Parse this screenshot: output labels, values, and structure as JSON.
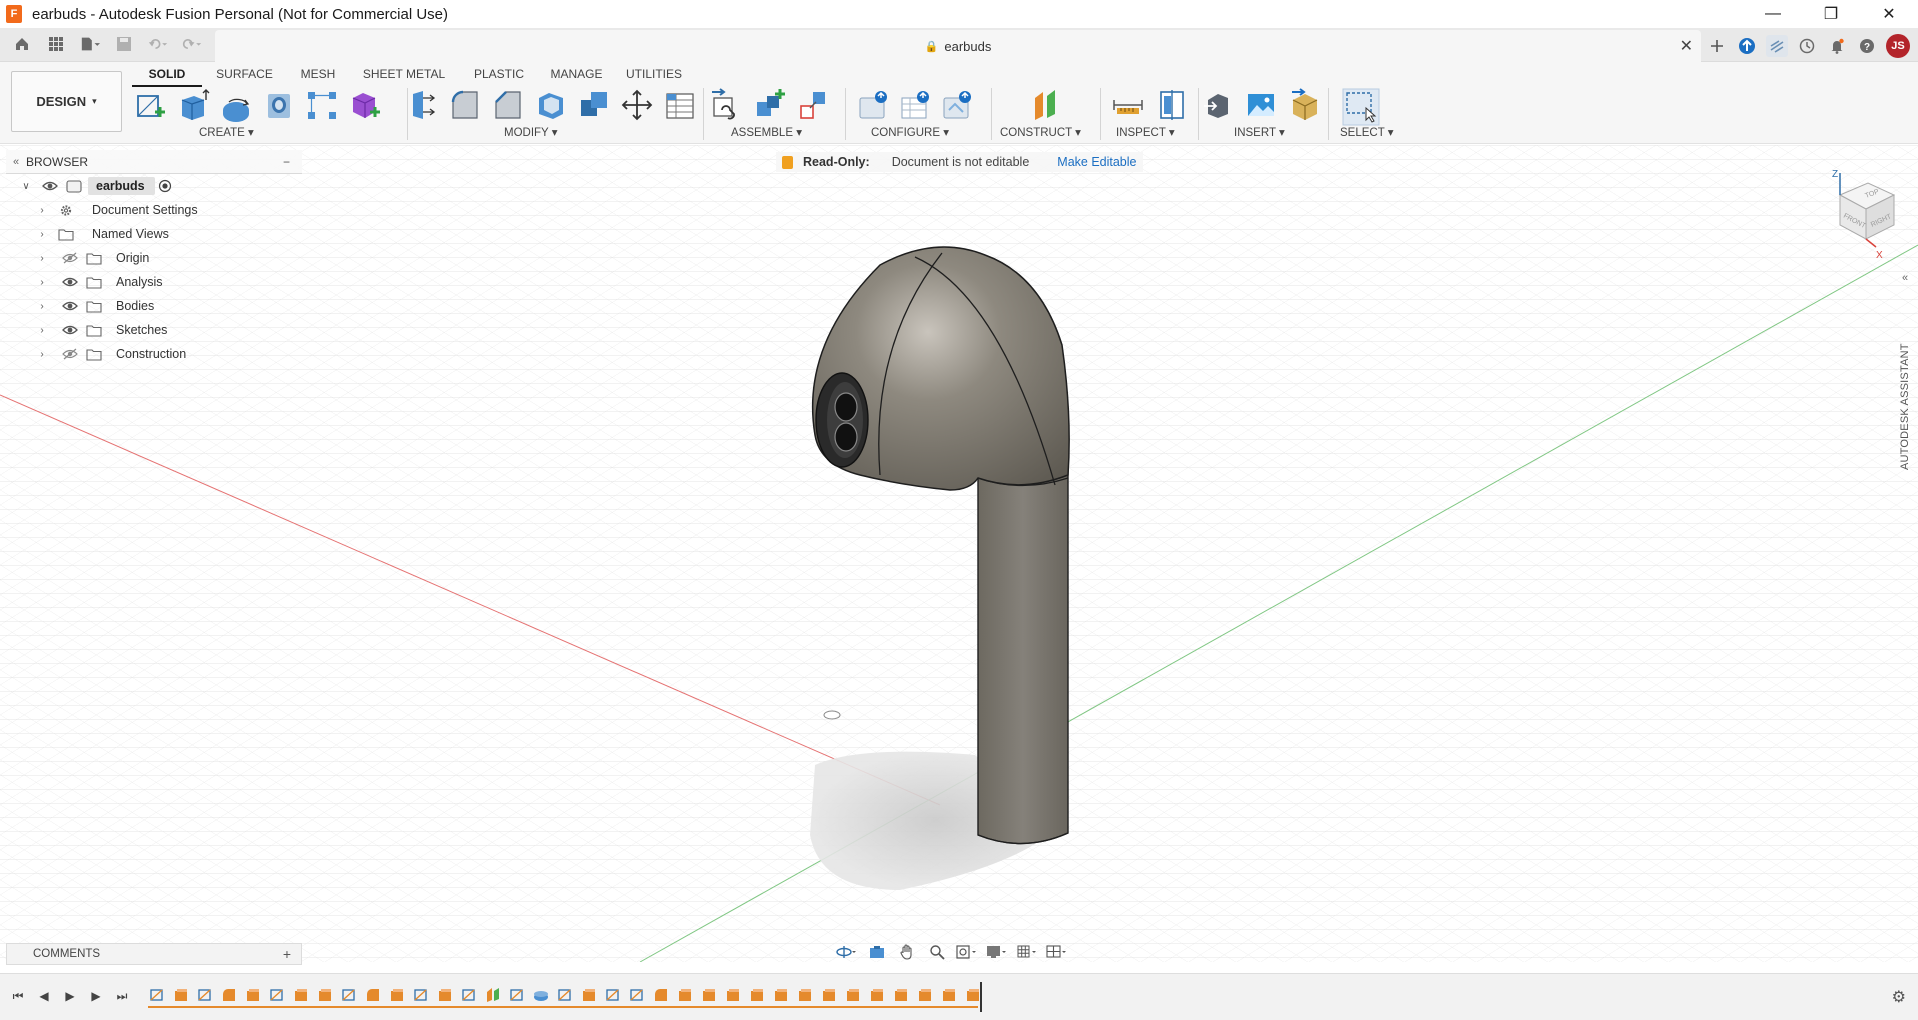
{
  "window": {
    "title": "earbuds - Autodesk Fusion Personal (Not for Commercial Use)",
    "app_logo": "F",
    "controls": [
      "minimize-icon",
      "restore-icon",
      "close-icon"
    ]
  },
  "doc_tab": {
    "title": "earbuds"
  },
  "user": {
    "initials": "JS"
  },
  "ribbon": {
    "workspace": "DESIGN",
    "tabs": [
      "SOLID",
      "SURFACE",
      "MESH",
      "SHEET METAL",
      "PLASTIC",
      "MANAGE",
      "UTILITIES"
    ],
    "active_tab": "SOLID",
    "groups": [
      "CREATE",
      "MODIFY",
      "ASSEMBLE",
      "CONFIGURE",
      "CONSTRUCT",
      "INSPECT",
      "INSERT",
      "SELECT"
    ]
  },
  "browser": {
    "title": "BROWSER",
    "root": "earbuds",
    "items": [
      "Document Settings",
      "Named Views",
      "Origin",
      "Analysis",
      "Bodies",
      "Sketches",
      "Construction"
    ]
  },
  "readonly": {
    "label": "Read-Only:",
    "message": "Document is not editable",
    "link": "Make Editable"
  },
  "viewcube": {
    "top": "TOP",
    "front": "FRONT",
    "right": "RIGHT",
    "axis_z": "Z",
    "axis_x": "X"
  },
  "assistant": {
    "label": "AUTODESK ASSISTANT"
  },
  "comments": {
    "label": "COMMENTS"
  },
  "colors": {
    "accent": "#1b6ec2",
    "brand": "#f26a1b",
    "timeline_feature": "#e58a2c",
    "readonly_lock": "#f0a020"
  }
}
